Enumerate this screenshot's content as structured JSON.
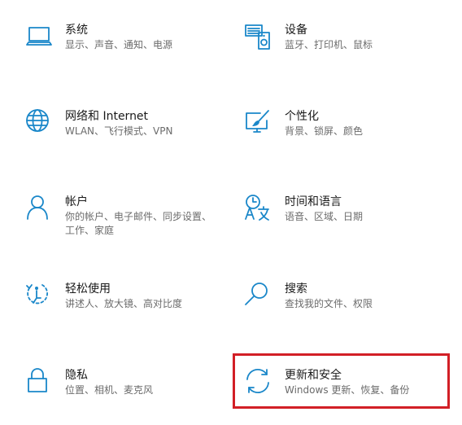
{
  "accent_color": "#1a87c9",
  "highlight_color": "#d21f26",
  "tiles": [
    {
      "title": "系统",
      "desc": "显示、声音、通知、电源",
      "icon": "laptop-icon"
    },
    {
      "title": "设备",
      "desc": "蓝牙、打印机、鼠标",
      "icon": "keyboard-speaker-icon"
    },
    {
      "title": "网络和 Internet",
      "desc": "WLAN、飞行模式、VPN",
      "icon": "globe-icon"
    },
    {
      "title": "个性化",
      "desc": "背景、锁屏、颜色",
      "icon": "paint-monitor-icon"
    },
    {
      "title": "帐户",
      "desc": "你的帐户、电子邮件、同步设置、工作、家庭",
      "icon": "person-icon"
    },
    {
      "title": "时间和语言",
      "desc": "语音、区域、日期",
      "icon": "time-language-icon"
    },
    {
      "title": "轻松使用",
      "desc": "讲述人、放大镜、高对比度",
      "icon": "ease-of-access-icon"
    },
    {
      "title": "搜索",
      "desc": "查找我的文件、权限",
      "icon": "magnifier-icon"
    },
    {
      "title": "隐私",
      "desc": "位置、相机、麦克风",
      "icon": "lock-icon"
    },
    {
      "title": "更新和安全",
      "desc": "Windows 更新、恢复、备份",
      "icon": "sync-arrows-icon"
    }
  ]
}
